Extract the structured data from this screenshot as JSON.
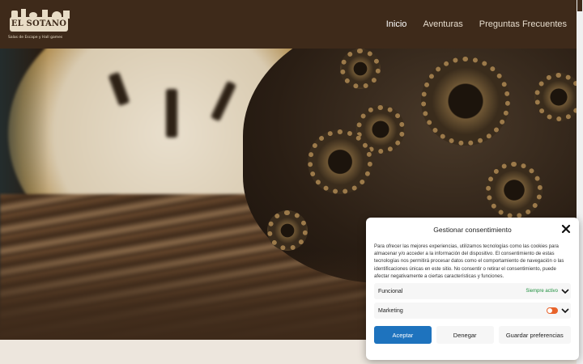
{
  "site": {
    "logo_title": "EL SOTANO",
    "logo_subtitle": "Salas de Escape y Hall games"
  },
  "nav": {
    "items": [
      {
        "label": "Inicio",
        "active": true
      },
      {
        "label": "Aventuras",
        "active": false
      },
      {
        "label": "Preguntas Frecuentes",
        "active": false
      }
    ]
  },
  "colors": {
    "header_bg": "#3e2a1a",
    "accept_button": "#1e73be",
    "toggle_active": "#e8632a",
    "always_active_text": "#1e8f3e"
  },
  "consent": {
    "title": "Gestionar consentimiento",
    "description": "Para ofrecer las mejores experiencias, utilizamos tecnologías como las cookies para almacenar y/o acceder a la información del dispositivo. El consentimiento de estas tecnologías nos permitirá procesar datos como el comportamiento de navegación o las identificaciones únicas en este sitio. No consentir o retirar el consentimiento, puede afectar negativamente a ciertas características y funciones.",
    "categories": [
      {
        "label": "Funcional",
        "status": "Siempre activo"
      },
      {
        "label": "Marketing",
        "status": ""
      }
    ],
    "buttons": {
      "accept": "Aceptar",
      "deny": "Denegar",
      "save": "Guardar preferencias"
    }
  },
  "icons": {
    "close": "close-icon",
    "chevron": "chevron-down-icon"
  }
}
